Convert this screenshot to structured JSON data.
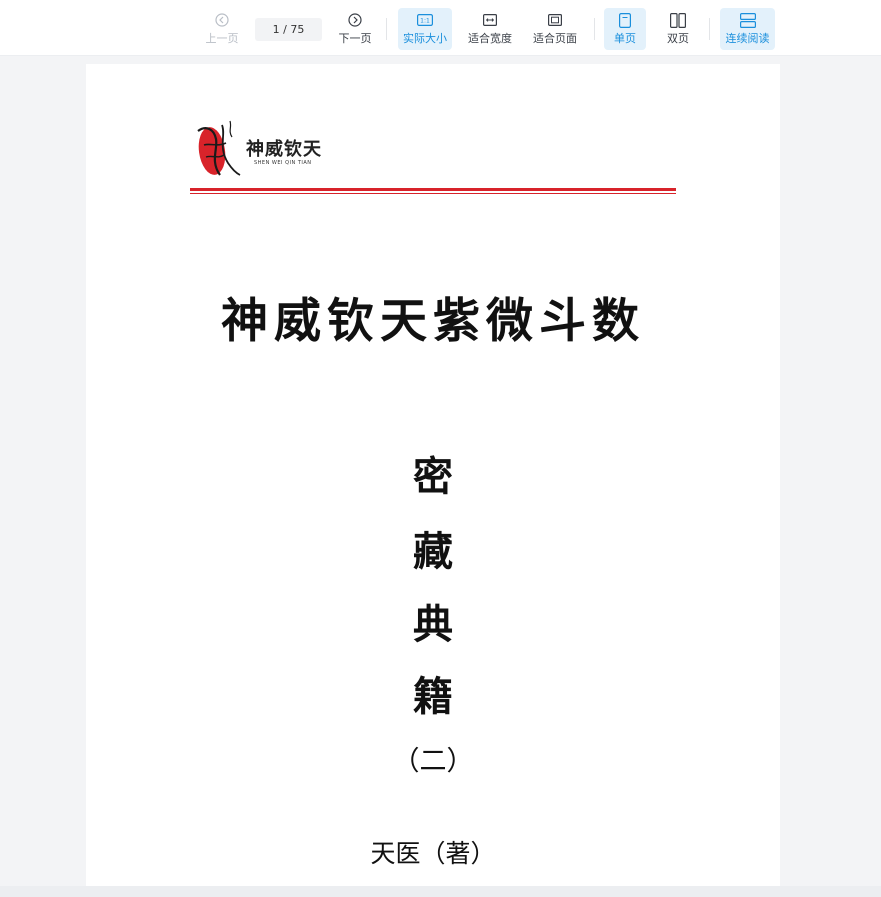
{
  "toolbar": {
    "prev_label": "上一页",
    "page_indicator": "1 / 75",
    "next_label": "下一页",
    "actual_size_label": "实际大小",
    "fit_width_label": "适合宽度",
    "fit_page_label": "适合页面",
    "single_page_label": "单页",
    "double_page_label": "双页",
    "continuous_label": "连续阅读",
    "accent_color": "#1a8fdc",
    "active_bg": "#e3f1fb"
  },
  "document": {
    "logo_text": "神威钦天",
    "logo_subtext": "SHEN WEI QIN TIAN",
    "title": "神威钦天紫微斗数",
    "vertical_title": [
      "密",
      "藏",
      "典",
      "籍"
    ],
    "volume": "（二）",
    "author": "天医（著）",
    "rule_color": "#d8232a"
  }
}
